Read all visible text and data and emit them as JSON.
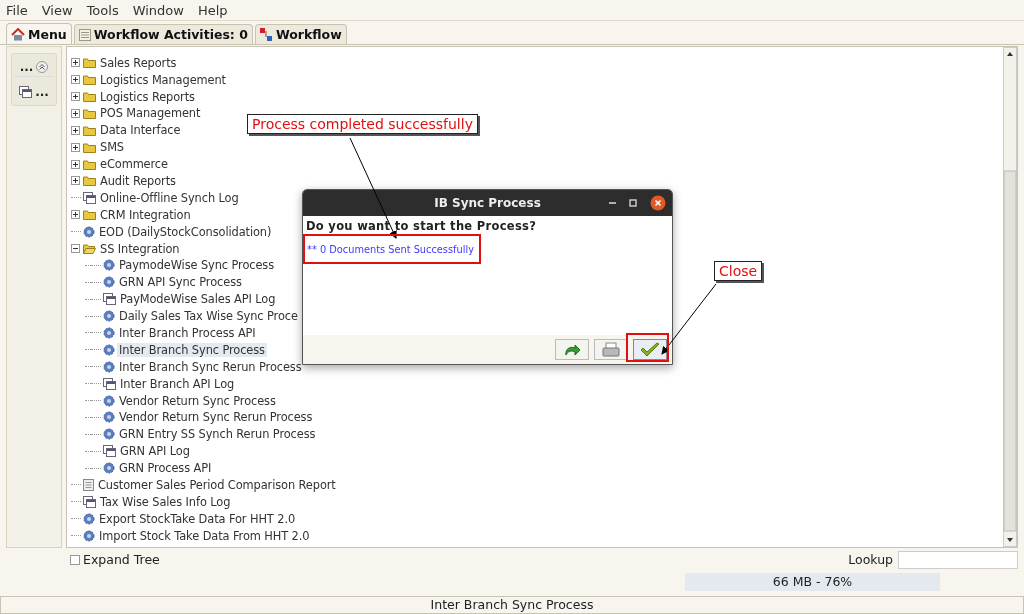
{
  "menu_bar": [
    "File",
    "View",
    "Tools",
    "Window",
    "Help"
  ],
  "tabs": [
    {
      "label": "Menu",
      "kind": "home",
      "selected": true
    },
    {
      "label": "Workflow Activities: 0",
      "kind": "list",
      "selected": false
    },
    {
      "label": "Workflow",
      "kind": "flow",
      "selected": false
    }
  ],
  "side_panel": {
    "items": [
      {
        "label": "...",
        "kind": "collapse"
      },
      {
        "label": "...",
        "kind": "windows"
      }
    ]
  },
  "tree": {
    "items": [
      {
        "label": "Sales Reports",
        "kind": "folder",
        "expanded": false,
        "selected": false
      },
      {
        "label": "Logistics Management",
        "kind": "folder",
        "expanded": false,
        "selected": false
      },
      {
        "label": "Logistics Reports",
        "kind": "folder",
        "expanded": false,
        "selected": false
      },
      {
        "label": "POS Management",
        "kind": "folder",
        "expanded": false,
        "selected": false
      },
      {
        "label": "Data Interface",
        "kind": "folder",
        "expanded": false,
        "selected": false
      },
      {
        "label": "SMS",
        "kind": "folder",
        "expanded": false,
        "selected": false
      },
      {
        "label": "eCommerce",
        "kind": "folder",
        "expanded": false,
        "selected": false
      },
      {
        "label": "Audit Reports",
        "kind": "folder",
        "expanded": false,
        "selected": false
      },
      {
        "label": "Online-Offline Synch Log",
        "kind": "log",
        "selected": false
      },
      {
        "label": "CRM Integration",
        "kind": "folder",
        "expanded": false,
        "selected": false
      },
      {
        "label": "EOD (DailyStockConsolidation)",
        "kind": "process",
        "selected": false
      },
      {
        "label": "SS Integration",
        "kind": "folder",
        "expanded": true,
        "selected": false,
        "children": [
          {
            "label": "PaymodeWise Sync Process",
            "kind": "process",
            "selected": false
          },
          {
            "label": "GRN API Sync Process",
            "kind": "process",
            "selected": false
          },
          {
            "label": "PayModeWise Sales API Log",
            "kind": "log",
            "selected": false
          },
          {
            "label": "Daily Sales Tax Wise Sync Proce",
            "kind": "process",
            "selected": false
          },
          {
            "label": "Inter Branch Process API",
            "kind": "process",
            "selected": false
          },
          {
            "label": "Inter Branch Sync Process",
            "kind": "process",
            "selected": true
          },
          {
            "label": "Inter Branch Sync Rerun Process",
            "kind": "process",
            "selected": false
          },
          {
            "label": "Inter Branch API Log",
            "kind": "log",
            "selected": false
          },
          {
            "label": "Vendor Return Sync Process",
            "kind": "process",
            "selected": false
          },
          {
            "label": "Vendor Return Sync Rerun Process",
            "kind": "process",
            "selected": false
          },
          {
            "label": "GRN Entry SS Synch Rerun Process",
            "kind": "process",
            "selected": false
          },
          {
            "label": "GRN API Log",
            "kind": "log",
            "selected": false
          },
          {
            "label": "GRN Process API",
            "kind": "process",
            "selected": false
          }
        ]
      },
      {
        "label": "Customer Sales Period Comparison Report",
        "kind": "report",
        "selected": false
      },
      {
        "label": "Tax Wise Sales Info Log",
        "kind": "log",
        "selected": false
      },
      {
        "label": "Export StockTake Data For HHT 2.0",
        "kind": "process",
        "selected": false
      },
      {
        "label": "Import Stock Take Data From HHT 2.0",
        "kind": "process",
        "selected": false
      }
    ]
  },
  "expand_tree": {
    "label": "Expand Tree",
    "checked": false
  },
  "lookup": {
    "label": "Lookup"
  },
  "memory": {
    "reading": "66 MB - 76%"
  },
  "status_bar": "Inter Branch Sync Process",
  "dialog": {
    "title": "IB Sync Process",
    "question": "Do you want to start the Process?",
    "message": "** 0 Documents Sent Successfully",
    "buttons": [
      {
        "kind": "redo"
      },
      {
        "kind": "print"
      },
      {
        "kind": "ok"
      }
    ]
  },
  "annotations": [
    {
      "text": "Process completed successfully",
      "kind": "callout"
    },
    {
      "text": "Close",
      "kind": "callout"
    }
  ]
}
